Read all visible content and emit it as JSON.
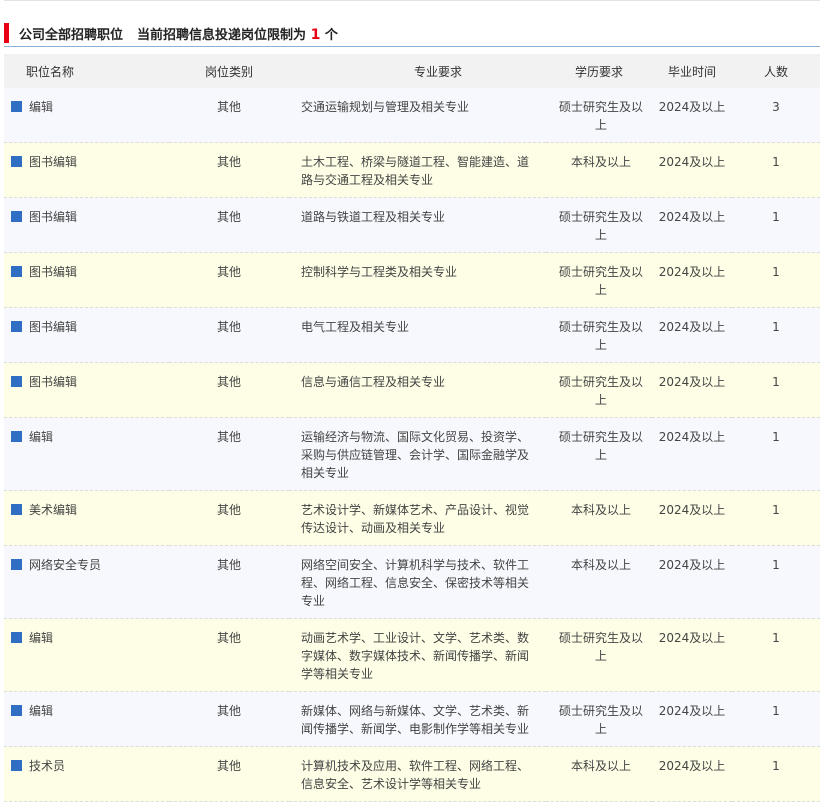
{
  "header": {
    "title_prefix": "公司全部招聘职位",
    "limit_label": "当前招聘信息投递岗位限制为",
    "limit_count": "1",
    "limit_unit": "个"
  },
  "table": {
    "columns": [
      "职位名称",
      "岗位类别",
      "专业要求",
      "学历要求",
      "毕业时间",
      "人数"
    ],
    "rows": [
      {
        "name": "编辑",
        "category": "其他",
        "major": "交通运输规划与管理及相关专业",
        "degree": "硕士研究生及以上",
        "grad": "2024及以上",
        "count": "3"
      },
      {
        "name": "图书编辑",
        "category": "其他",
        "major": "土木工程、桥梁与隧道工程、智能建造、道路与交通工程及相关专业",
        "degree": "本科及以上",
        "grad": "2024及以上",
        "count": "1"
      },
      {
        "name": "图书编辑",
        "category": "其他",
        "major": "道路与铁道工程及相关专业",
        "degree": "硕士研究生及以上",
        "grad": "2024及以上",
        "count": "1"
      },
      {
        "name": "图书编辑",
        "category": "其他",
        "major": "控制科学与工程类及相关专业",
        "degree": "硕士研究生及以上",
        "grad": "2024及以上",
        "count": "1"
      },
      {
        "name": "图书编辑",
        "category": "其他",
        "major": "电气工程及相关专业",
        "degree": "硕士研究生及以上",
        "grad": "2024及以上",
        "count": "1"
      },
      {
        "name": "图书编辑",
        "category": "其他",
        "major": "信息与通信工程及相关专业",
        "degree": "硕士研究生及以上",
        "grad": "2024及以上",
        "count": "1"
      },
      {
        "name": "编辑",
        "category": "其他",
        "major": "运输经济与物流、国际文化贸易、投资学、采购与供应链管理、会计学、国际金融学及相关专业",
        "degree": "硕士研究生及以上",
        "grad": "2024及以上",
        "count": "1"
      },
      {
        "name": "美术编辑",
        "category": "其他",
        "major": "艺术设计学、新媒体艺术、产品设计、视觉传达设计、动画及相关专业",
        "degree": "本科及以上",
        "grad": "2024及以上",
        "count": "1"
      },
      {
        "name": "网络安全专员",
        "category": "其他",
        "major": "网络空间安全、计算机科学与技术、软件工程、网络工程、信息安全、保密技术等相关专业",
        "degree": "本科及以上",
        "grad": "2024及以上",
        "count": "1"
      },
      {
        "name": "编辑",
        "category": "其他",
        "major": "动画艺术学、工业设计、文学、艺术类、数字媒体、数字媒体技术、新闻传播学、新闻学等相关专业",
        "degree": "硕士研究生及以上",
        "grad": "2024及以上",
        "count": "1"
      },
      {
        "name": "编辑",
        "category": "其他",
        "major": "新媒体、网络与新媒体、文学、艺术类、新闻传播学、新闻学、电影制作学等相关专业",
        "degree": "硕士研究生及以上",
        "grad": "2024及以上",
        "count": "1"
      },
      {
        "name": "技术员",
        "category": "其他",
        "major": "计算机技术及应用、软件工程、网络工程、信息安全、艺术设计学等相关专业",
        "degree": "本科及以上",
        "grad": "2024及以上",
        "count": "1"
      }
    ]
  },
  "colors": {
    "accent_red": "#e60012",
    "bullet_blue": "#2f6ec2",
    "row_odd": "#f7f8fd",
    "row_even": "#fefee6"
  }
}
